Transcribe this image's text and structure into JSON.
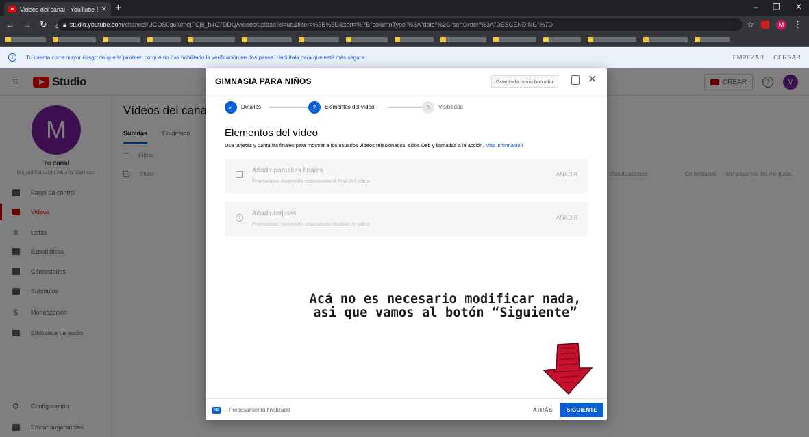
{
  "browser": {
    "tab_title": "Videos del canal - YouTube Stud",
    "tab_close": "✕",
    "new_tab": "+",
    "url_host": "studio.youtube.com",
    "url_path": "/channel/UCOS0q6fumejFCj8_b4C7DDQ/videos/upload?d=ud&filter=%5B%5D&sort=%7B\"columnType\"%3A\"date\"%2C\"sortOrder\"%3A\"DESCENDING\"%7D",
    "profile_initial": "M"
  },
  "banner": {
    "message": "Tu cuenta corre mayor riesgo de que la pirateen porque no has habilitado la verificación en dos pasos. Habilítala para que esté más segura.",
    "start": "EMPEZAR",
    "close": "CERRAR"
  },
  "header": {
    "logo_text": "Studio",
    "create": "CREAR",
    "avatar_initial": "M"
  },
  "sidebar": {
    "avatar_initial": "M",
    "channel_label": "Tu canal",
    "owner": "Miguel Eduardo Aburto Martinez",
    "items": [
      {
        "label": "Panel de control",
        "icon": "dashboard-icon"
      },
      {
        "label": "Videos",
        "icon": "videos-icon"
      },
      {
        "label": "Listas",
        "icon": "playlists-icon"
      },
      {
        "label": "Estadísticas",
        "icon": "analytics-icon"
      },
      {
        "label": "Comentarios",
        "icon": "comments-icon"
      },
      {
        "label": "Subtítulos",
        "icon": "subtitles-icon"
      },
      {
        "label": "Monetización",
        "icon": "monetization-icon"
      },
      {
        "label": "Biblioteca de audio",
        "icon": "audio-library-icon"
      }
    ],
    "settings": "Configuración",
    "feedback": "Enviar sugerencias"
  },
  "page": {
    "title": "Vídeos del canal",
    "tabs": [
      "Subidas",
      "En directo"
    ],
    "filter": "Filtrar",
    "columns": {
      "video": "Vídeo",
      "views": "Visualizaciones",
      "comments": "Comentarios",
      "likes": "Me gusta (vs. No me gusta)"
    }
  },
  "dialog": {
    "title": "GIMNASIA PARA NIÑOS",
    "draft_status": "Guardado como borrador",
    "steps": [
      {
        "number": "✓",
        "label": "Detalles",
        "state": "done"
      },
      {
        "number": "2",
        "label": "Elementos del vídeo",
        "state": "current"
      },
      {
        "number": "3",
        "label": "Visibilidad",
        "state": "pending"
      }
    ],
    "section_title": "Elementos del vídeo",
    "section_desc": "Usa tarjetas y pantallas finales para mostrar a los usuarios vídeos relacionados, sitios web y llamadas a la acción.",
    "more_info": "Más información",
    "cards": [
      {
        "title": "Añadir pantallas finales",
        "subtitle": "Promociona contenido relacionado al final del vídeo",
        "action": "AÑADIR"
      },
      {
        "title": "Añadir tarjetas",
        "subtitle": "Promociona contenido relacionado durante el vídeo",
        "action": "AÑADIR"
      }
    ],
    "annotation_line1": "Acá no es necesario modificar nada,",
    "annotation_line2": "asi que vamos al botón “Siguiente”",
    "processing": "Procesamiento finalizado",
    "hd_badge": "HD",
    "back": "ATRÁS",
    "next": "SIGUIENTE"
  },
  "colors": {
    "accent_blue": "#065fd4",
    "brand_red": "#ff0000",
    "avatar_purple": "#7b1fa2",
    "arrow_red": "#c8102e"
  }
}
